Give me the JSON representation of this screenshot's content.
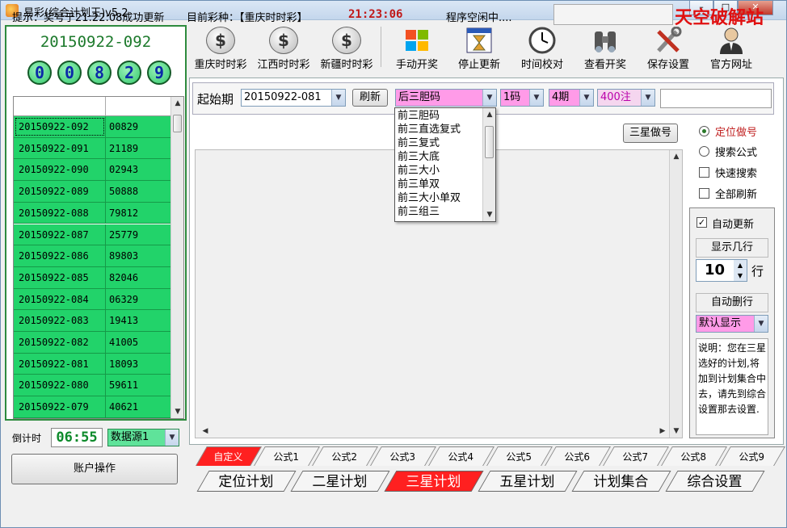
{
  "window": {
    "title": "易彩(综合计划王)v5.2",
    "btn_min": "–",
    "btn_max": "□",
    "btn_close": "✕"
  },
  "current": {
    "period": "20150922-092",
    "balls": [
      "0",
      "0",
      "8",
      "2",
      "9"
    ]
  },
  "history": [
    {
      "period": "20150922-092",
      "num": "00829"
    },
    {
      "period": "20150922-091",
      "num": "21189"
    },
    {
      "period": "20150922-090",
      "num": "02943"
    },
    {
      "period": "20150922-089",
      "num": "50888"
    },
    {
      "period": "20150922-088",
      "num": "79812"
    },
    {
      "period": "20150922-087",
      "num": "25779"
    },
    {
      "period": "20150922-086",
      "num": "89803"
    },
    {
      "period": "20150922-085",
      "num": "82046"
    },
    {
      "period": "20150922-084",
      "num": "06329"
    },
    {
      "period": "20150922-083",
      "num": "19413"
    },
    {
      "period": "20150922-082",
      "num": "41005"
    },
    {
      "period": "20150922-081",
      "num": "18093"
    },
    {
      "period": "20150922-080",
      "num": "59611"
    },
    {
      "period": "20150922-079",
      "num": "40621"
    }
  ],
  "countdown": {
    "label": "倒计时",
    "value": "06:55",
    "source": "数据源1"
  },
  "account_button": "账户操作",
  "toolbar": [
    {
      "label": "重庆时时彩",
      "icon": "dollar-coin-icon"
    },
    {
      "label": "江西时时彩",
      "icon": "dollar-coin-icon"
    },
    {
      "label": "新疆时时彩",
      "icon": "dollar-coin-icon"
    },
    {
      "label": "手动开奖",
      "icon": "windows-logo-icon"
    },
    {
      "label": "停止更新",
      "icon": "hourglass-window-icon"
    },
    {
      "label": "时间校对",
      "icon": "clock-icon"
    },
    {
      "label": "查看开奖",
      "icon": "binoculars-icon"
    },
    {
      "label": "保存设置",
      "icon": "tools-icon"
    },
    {
      "label": "官方网址",
      "icon": "person-icon"
    }
  ],
  "filter": {
    "start_label": "起始期",
    "start_value": "20150922-081",
    "refresh": "刷新",
    "plan_type": "后三胆码",
    "code_count": "1码",
    "periods": "4期",
    "bets": "400注"
  },
  "dropdown_items": [
    "前三胆码",
    "前三直选复式",
    "前三复式",
    "前三大底",
    "前三大小",
    "前三单双",
    "前三大小单双",
    "前三组三"
  ],
  "sanxing_button": "三星做号",
  "options": {
    "radio_fixed": "定位做号",
    "radio_search": "搜索公式",
    "check_fast": "快速搜索",
    "check_all": "全部刷新"
  },
  "right_panel": {
    "auto_update": "自动更新",
    "rows_label": "显示几行",
    "rows_value": "10",
    "rows_unit": "行",
    "auto_delete": "自动删行",
    "display_mode": "默认显示",
    "note": "说明：您在三星选好的计划,将加到计划集合中去，请先到综合设置那去设置."
  },
  "formula_tabs": [
    "自定义",
    "公式1",
    "公式2",
    "公式3",
    "公式4",
    "公式5",
    "公式6",
    "公式7",
    "公式8",
    "公式9"
  ],
  "main_tabs": [
    "定位计划",
    "二星计划",
    "三星计划",
    "五星计划",
    "计划集合",
    "综合设置"
  ],
  "status": {
    "tip": "提示：奖号于21:22:08成功更新",
    "lottery": "目前彩种：【重庆时时彩】",
    "time": "21:23:06",
    "state": "程序空闲中....",
    "watermark": "天空破解站"
  }
}
